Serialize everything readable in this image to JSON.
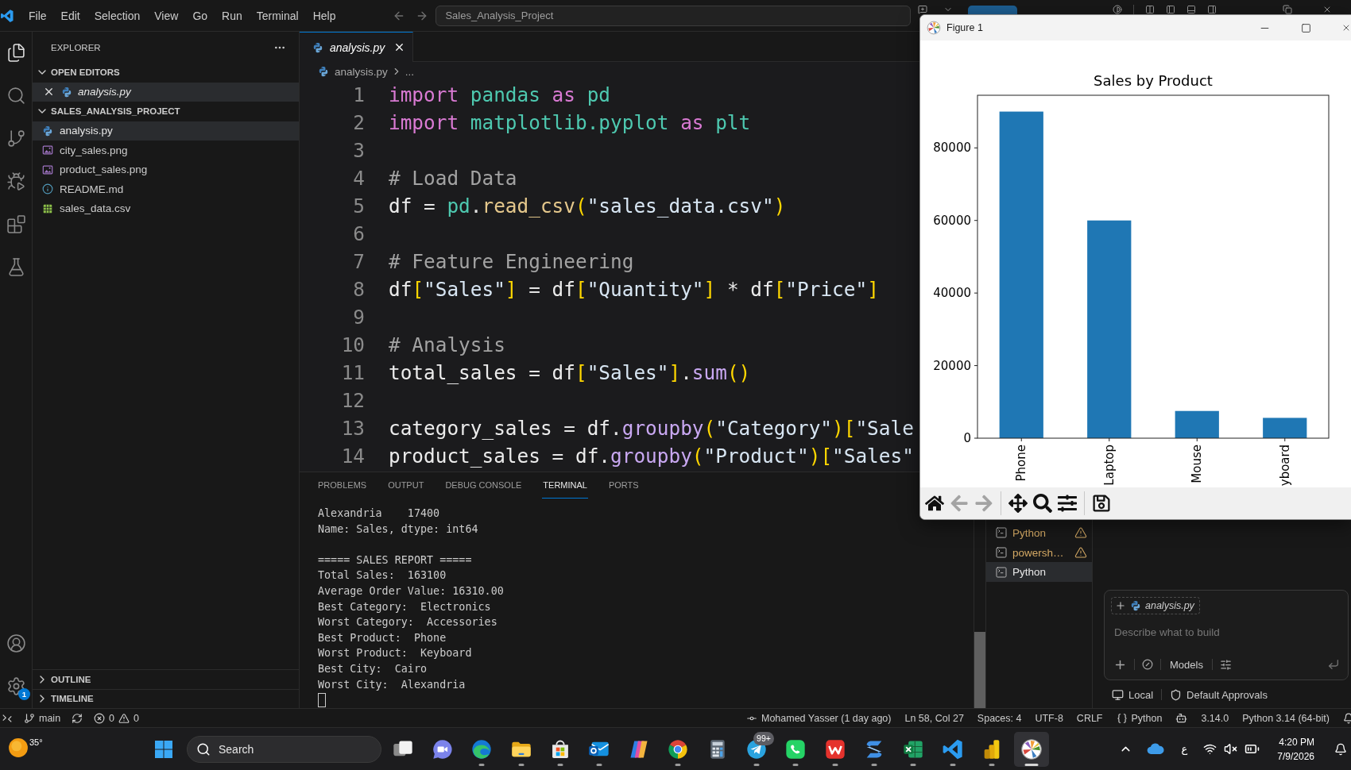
{
  "title_bar": {
    "menu": [
      "File",
      "Edit",
      "Selection",
      "View",
      "Go",
      "Run",
      "Terminal",
      "Help"
    ],
    "search": "Sales_Analysis_Project"
  },
  "activity_bar": {
    "items": [
      {
        "kind": "explorer",
        "selected": true
      },
      {
        "kind": "search",
        "selected": false
      },
      {
        "kind": "source_control",
        "selected": false
      },
      {
        "kind": "run_debug",
        "selected": false
      },
      {
        "kind": "extensions",
        "selected": false
      },
      {
        "kind": "testing",
        "selected": false
      }
    ],
    "settings_badge": "1"
  },
  "sidebar": {
    "title": "EXPLORER",
    "sections": [
      {
        "kind": "open_editors",
        "title": "OPEN EDITORS",
        "expanded": true,
        "items": [
          {
            "name": "analysis.py",
            "kind": "python",
            "preview": true,
            "selected": true
          }
        ]
      },
      {
        "kind": "folder",
        "title": "SALES_ANALYSIS_PROJECT",
        "expanded": true,
        "items": [
          {
            "name": "analysis.py",
            "kind": "python",
            "selected": true
          },
          {
            "name": "city_sales.png",
            "kind": "image",
            "selected": false
          },
          {
            "name": "product_sales.png",
            "kind": "image",
            "selected": false
          },
          {
            "name": "README.md",
            "kind": "readme",
            "selected": false
          },
          {
            "name": "sales_data.csv",
            "kind": "csv",
            "selected": false
          }
        ]
      }
    ],
    "footer_sections": [
      {
        "title": "OUTLINE",
        "expanded": false
      },
      {
        "title": "TIMELINE",
        "expanded": false
      }
    ]
  },
  "editor": {
    "tabs": [
      {
        "name": "analysis.py",
        "kind": "python",
        "preview": true,
        "selected": true
      }
    ],
    "breadcrumb": {
      "file": "analysis.py",
      "kind": "python",
      "rest": "..."
    },
    "lines": [
      {
        "number": "1",
        "tokens": [
          {
            "kind": "keyword",
            "text": "import "
          },
          {
            "kind": "module",
            "text": "pandas "
          },
          {
            "kind": "keyword",
            "text": "as "
          },
          {
            "kind": "module",
            "text": "pd"
          }
        ]
      },
      {
        "number": "2",
        "tokens": [
          {
            "kind": "keyword",
            "text": "import "
          },
          {
            "kind": "module",
            "text": "matplotlib.pyplot "
          },
          {
            "kind": "keyword",
            "text": "as "
          },
          {
            "kind": "module",
            "text": "plt"
          }
        ]
      },
      {
        "number": "3"
      },
      {
        "number": "4",
        "tokens": [
          {
            "kind": "comment",
            "text": "# Load Data"
          }
        ]
      },
      {
        "number": "5",
        "tokens": [
          {
            "kind": "variable",
            "text": "df"
          },
          {
            "kind": "plain",
            "text": " = "
          },
          {
            "kind": "module",
            "text": "pd"
          },
          {
            "kind": "plain",
            "text": "."
          },
          {
            "kind": "function",
            "text": "read_csv"
          },
          {
            "kind": "bracket",
            "text": "("
          },
          {
            "kind": "string",
            "text": "\"sales_data.csv\""
          },
          {
            "kind": "bracket",
            "text": ")"
          }
        ]
      },
      {
        "number": "6"
      },
      {
        "number": "7",
        "tokens": [
          {
            "kind": "comment",
            "text": "# Feature Engineering"
          }
        ]
      },
      {
        "number": "8",
        "tokens": [
          {
            "kind": "variable",
            "text": "df"
          },
          {
            "kind": "bracket",
            "text": "["
          },
          {
            "kind": "string",
            "text": "\"Sales\""
          },
          {
            "kind": "bracket",
            "text": "]"
          },
          {
            "kind": "plain",
            "text": " = "
          },
          {
            "kind": "variable",
            "text": "df"
          },
          {
            "kind": "bracket",
            "text": "["
          },
          {
            "kind": "string",
            "text": "\"Quantity\""
          },
          {
            "kind": "bracket",
            "text": "]"
          },
          {
            "kind": "plain",
            "text": " * "
          },
          {
            "kind": "variable",
            "text": "df"
          },
          {
            "kind": "bracket",
            "text": "["
          },
          {
            "kind": "string",
            "text": "\"Price\""
          },
          {
            "kind": "bracket",
            "text": "]"
          }
        ]
      },
      {
        "number": "9"
      },
      {
        "number": "10",
        "tokens": [
          {
            "kind": "comment",
            "text": "# Analysis"
          }
        ]
      },
      {
        "number": "11",
        "tokens": [
          {
            "kind": "variable",
            "text": "total_sales"
          },
          {
            "kind": "plain",
            "text": " = "
          },
          {
            "kind": "variable",
            "text": "df"
          },
          {
            "kind": "bracket",
            "text": "["
          },
          {
            "kind": "string",
            "text": "\"Sales\""
          },
          {
            "kind": "bracket",
            "text": "]"
          },
          {
            "kind": "plain",
            "text": "."
          },
          {
            "kind": "method",
            "text": "sum"
          },
          {
            "kind": "bracket",
            "text": "()"
          }
        ]
      },
      {
        "number": "12"
      },
      {
        "number": "13",
        "tokens": [
          {
            "kind": "variable",
            "text": "category_sales"
          },
          {
            "kind": "plain",
            "text": " = "
          },
          {
            "kind": "variable",
            "text": "df"
          },
          {
            "kind": "plain",
            "text": "."
          },
          {
            "kind": "method",
            "text": "groupby"
          },
          {
            "kind": "bracket",
            "text": "("
          },
          {
            "kind": "string",
            "text": "\"Category\""
          },
          {
            "kind": "bracket",
            "text": ")"
          },
          {
            "kind": "bracket",
            "text": "["
          },
          {
            "kind": "string",
            "text": "\"Sale"
          }
        ]
      },
      {
        "number": "14",
        "tokens": [
          {
            "kind": "variable",
            "text": "product_sales"
          },
          {
            "kind": "plain",
            "text": " = "
          },
          {
            "kind": "variable",
            "text": "df"
          },
          {
            "kind": "plain",
            "text": "."
          },
          {
            "kind": "method",
            "text": "groupby"
          },
          {
            "kind": "bracket",
            "text": "("
          },
          {
            "kind": "string",
            "text": "\"Product\""
          },
          {
            "kind": "bracket",
            "text": ")"
          },
          {
            "kind": "bracket",
            "text": "["
          },
          {
            "kind": "string",
            "text": "\"Sales\""
          }
        ]
      }
    ]
  },
  "panel": {
    "tabs": [
      {
        "label": "PROBLEMS",
        "selected": false
      },
      {
        "label": "OUTPUT",
        "selected": false
      },
      {
        "label": "DEBUG CONSOLE",
        "selected": false
      },
      {
        "label": "TERMINAL",
        "selected": true
      },
      {
        "label": "PORTS",
        "selected": false
      }
    ],
    "terminal_blocks": [
      [
        "Alexandria    17400",
        "Name: Sales, dtype: int64"
      ],
      [
        "===== SALES REPORT =====",
        "Total Sales:  163100",
        "Average Order Value: 16310.00",
        "Best Category:  Electronics",
        "Worst Category:  Accessories",
        "Best Product:  Phone",
        "Worst Product:  Keyboard",
        "Best City:  Cairo",
        "Worst City:  Alexandria"
      ]
    ],
    "terminals": [
      {
        "name": "Python",
        "warning": true,
        "selected": false
      },
      {
        "name": "powersh…",
        "warning": true,
        "selected": false
      },
      {
        "name": "Python",
        "warning": false,
        "selected": true
      }
    ]
  },
  "chat": {
    "attachment": {
      "name": "analysis.py",
      "kind": "python"
    },
    "placeholder": "Describe what to build",
    "models": "Models",
    "location": "Local",
    "approvals": "Default Approvals"
  },
  "figure": {
    "title": "Figure 1",
    "chart_data": {
      "type": "bar",
      "title": "Sales by Product",
      "categories": [
        "Phone",
        "Laptop",
        "Mouse",
        "yboard"
      ],
      "values": [
        90000,
        60000,
        7500,
        5600
      ],
      "ylim": [
        0,
        94500
      ],
      "yticks": [
        0,
        20000,
        40000,
        60000,
        80000
      ]
    },
    "toolbar_groups": [
      [
        {
          "kind": "home",
          "disabled": false
        },
        {
          "kind": "back",
          "disabled": true
        },
        {
          "kind": "forward",
          "disabled": true
        }
      ],
      [
        {
          "kind": "pan",
          "disabled": false
        },
        {
          "kind": "zoom",
          "disabled": false
        },
        {
          "kind": "configure",
          "disabled": false
        }
      ],
      [
        {
          "kind": "save",
          "disabled": false
        }
      ]
    ]
  },
  "status_bar": {
    "branch": "main",
    "errors": "0",
    "warnings": "0",
    "blame": "Mohamed Yasser (1 day ago)",
    "cursor": "Ln 58, Col 27",
    "indentation": "Spaces: 4",
    "encoding": "UTF-8",
    "line_ending": "CRLF",
    "language": "Python",
    "version": "3.14.0",
    "interpreter": "Python 3.14 (64-bit)"
  },
  "taskbar": {
    "weather": "35°",
    "search": {
      "placeholder": "Search"
    },
    "apps": [
      {
        "kind": "task_view",
        "running": false,
        "selected": false
      },
      {
        "kind": "meet",
        "running": false,
        "selected": false
      },
      {
        "kind": "browser",
        "running": true,
        "selected": false
      },
      {
        "kind": "folder",
        "running": true,
        "selected": false
      },
      {
        "kind": "store",
        "running": true,
        "selected": false
      },
      {
        "kind": "mail",
        "running": true,
        "selected": false
      },
      {
        "kind": "assistant",
        "running": false,
        "selected": false
      },
      {
        "kind": "wheel_browser",
        "running": true,
        "selected": false
      },
      {
        "kind": "calculator",
        "running": false,
        "selected": false
      },
      {
        "kind": "messenger",
        "running": true,
        "selected": false,
        "badge": "99+"
      },
      {
        "kind": "chat_phone",
        "running": true,
        "selected": false
      },
      {
        "kind": "office",
        "running": true,
        "selected": false
      },
      {
        "kind": "stack",
        "running": true,
        "selected": false
      },
      {
        "kind": "spreadsheet",
        "running": true,
        "selected": false
      },
      {
        "kind": "code_editor",
        "running": true,
        "selected": false
      },
      {
        "kind": "report",
        "running": true,
        "selected": false
      },
      {
        "kind": "plot",
        "running": true,
        "selected": true
      }
    ],
    "language": "ع",
    "time": "4:20 PM",
    "date": "7/9/2026"
  }
}
